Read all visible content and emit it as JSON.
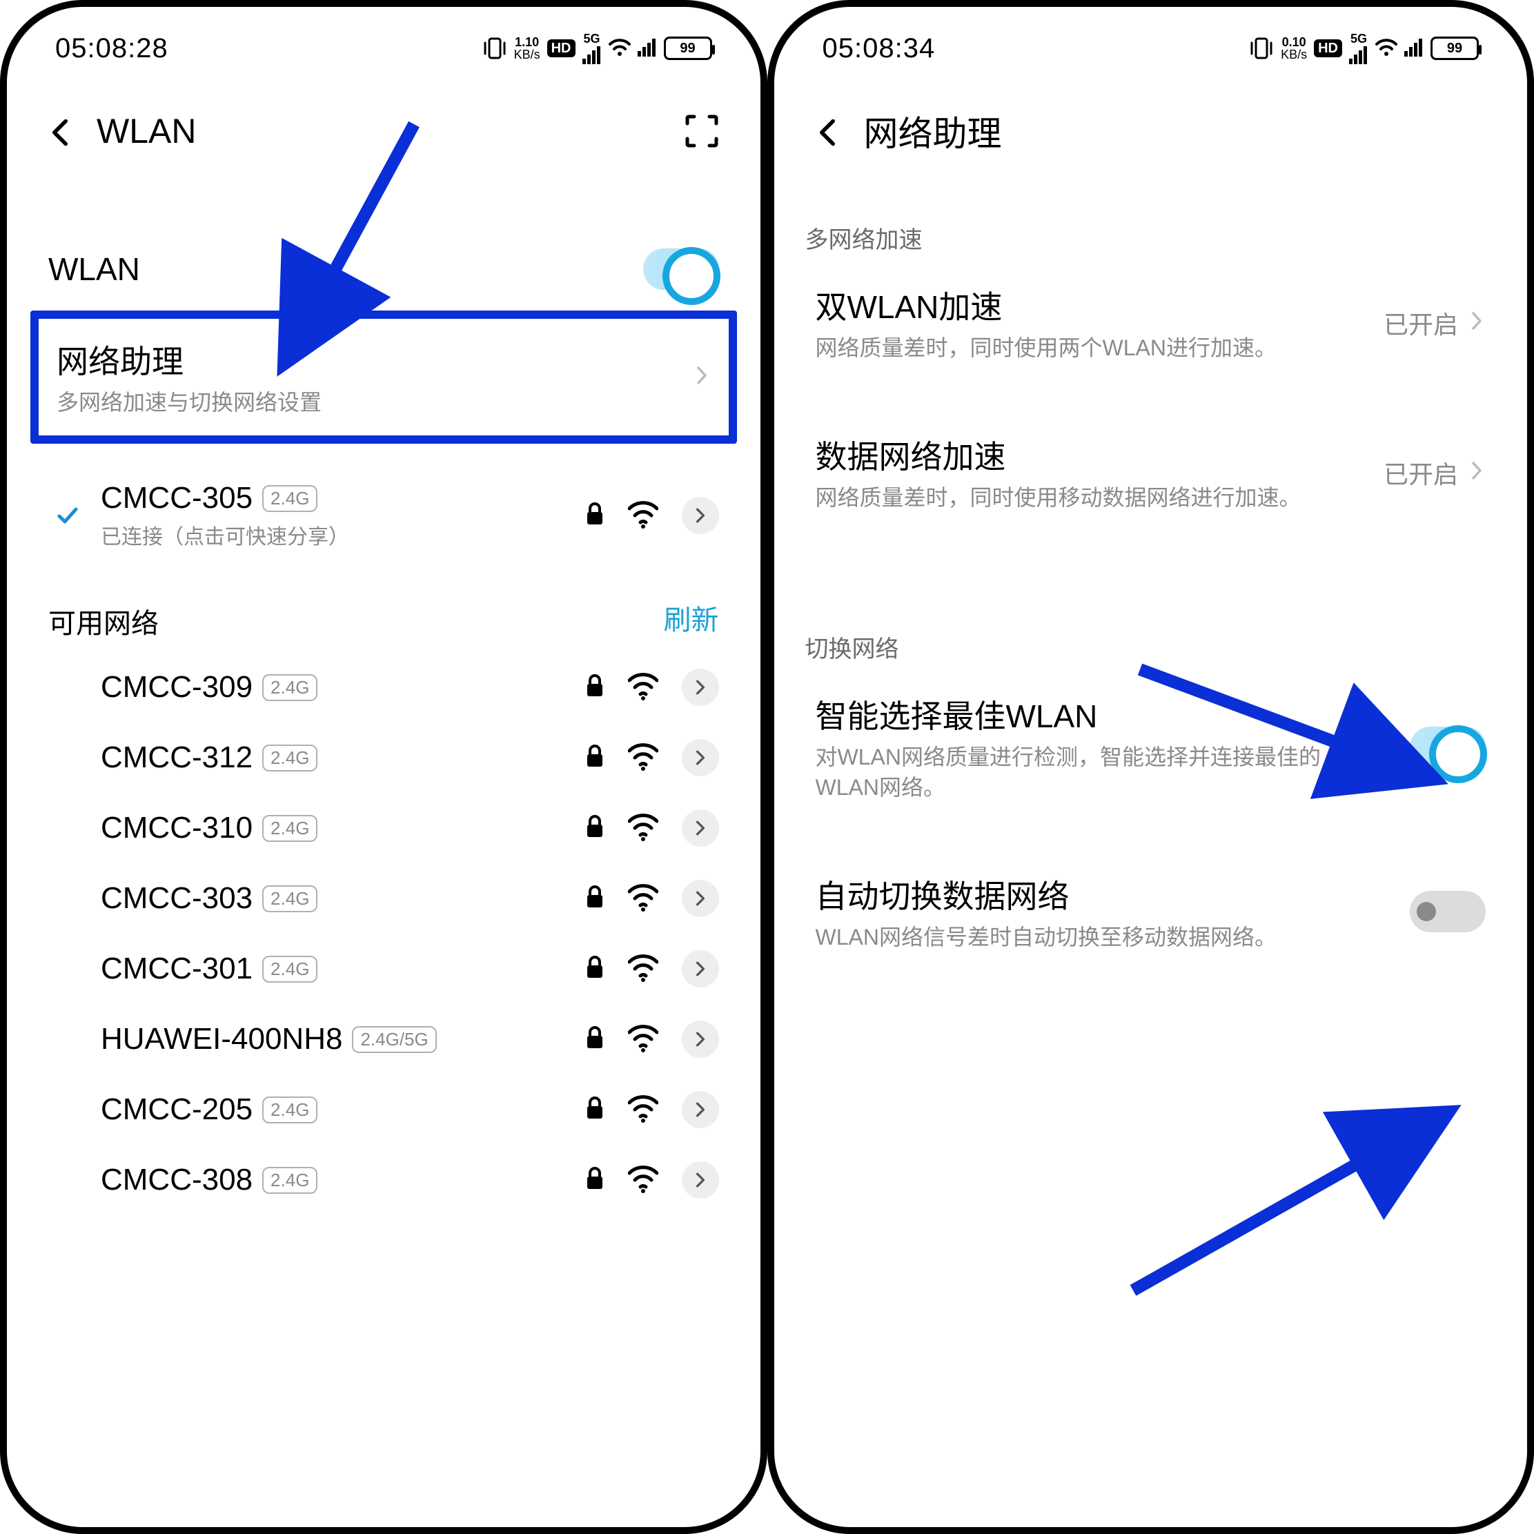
{
  "left": {
    "status": {
      "time": "05:08:28",
      "kbs_top": "1.10",
      "kbs_bottom": "KB/s",
      "hd": "HD",
      "fiveg": "5G",
      "battery": "99"
    },
    "header": {
      "title": "WLAN"
    },
    "wlan_toggle_label": "WLAN",
    "network_assistant": {
      "title": "网络助理",
      "subtitle": "多网络加速与切换网络设置"
    },
    "connected": {
      "name": "CMCC-305",
      "band": "2.4G",
      "subtitle": "已连接（点击可快速分享）"
    },
    "available_header": "可用网络",
    "refresh_label": "刷新",
    "networks": [
      {
        "name": "CMCC-309",
        "band": "2.4G"
      },
      {
        "name": "CMCC-312",
        "band": "2.4G"
      },
      {
        "name": "CMCC-310",
        "band": "2.4G"
      },
      {
        "name": "CMCC-303",
        "band": "2.4G"
      },
      {
        "name": "CMCC-301",
        "band": "2.4G"
      },
      {
        "name": "HUAWEI-400NH8",
        "band": "2.4G/5G"
      },
      {
        "name": "CMCC-205",
        "band": "2.4G"
      },
      {
        "name": "CMCC-308",
        "band": "2.4G"
      }
    ]
  },
  "right": {
    "status": {
      "time": "05:08:34",
      "kbs_top": "0.10",
      "kbs_bottom": "KB/s",
      "hd": "HD",
      "fiveg": "5G",
      "battery": "99"
    },
    "header": {
      "title": "网络助理"
    },
    "section1_label": "多网络加速",
    "dual_wlan": {
      "title": "双WLAN加速",
      "subtitle": "网络质量差时，同时使用两个WLAN进行加速。",
      "value": "已开启"
    },
    "data_accel": {
      "title": "数据网络加速",
      "subtitle": "网络质量差时，同时使用移动数据网络进行加速。",
      "value": "已开启"
    },
    "section2_label": "切换网络",
    "smart_wlan": {
      "title": "智能选择最佳WLAN",
      "subtitle": "对WLAN网络质量进行检测，智能选择并连接最佳的WLAN网络。"
    },
    "auto_switch": {
      "title": "自动切换数据网络",
      "subtitle": "WLAN网络信号差时自动切换至移动数据网络。"
    }
  }
}
